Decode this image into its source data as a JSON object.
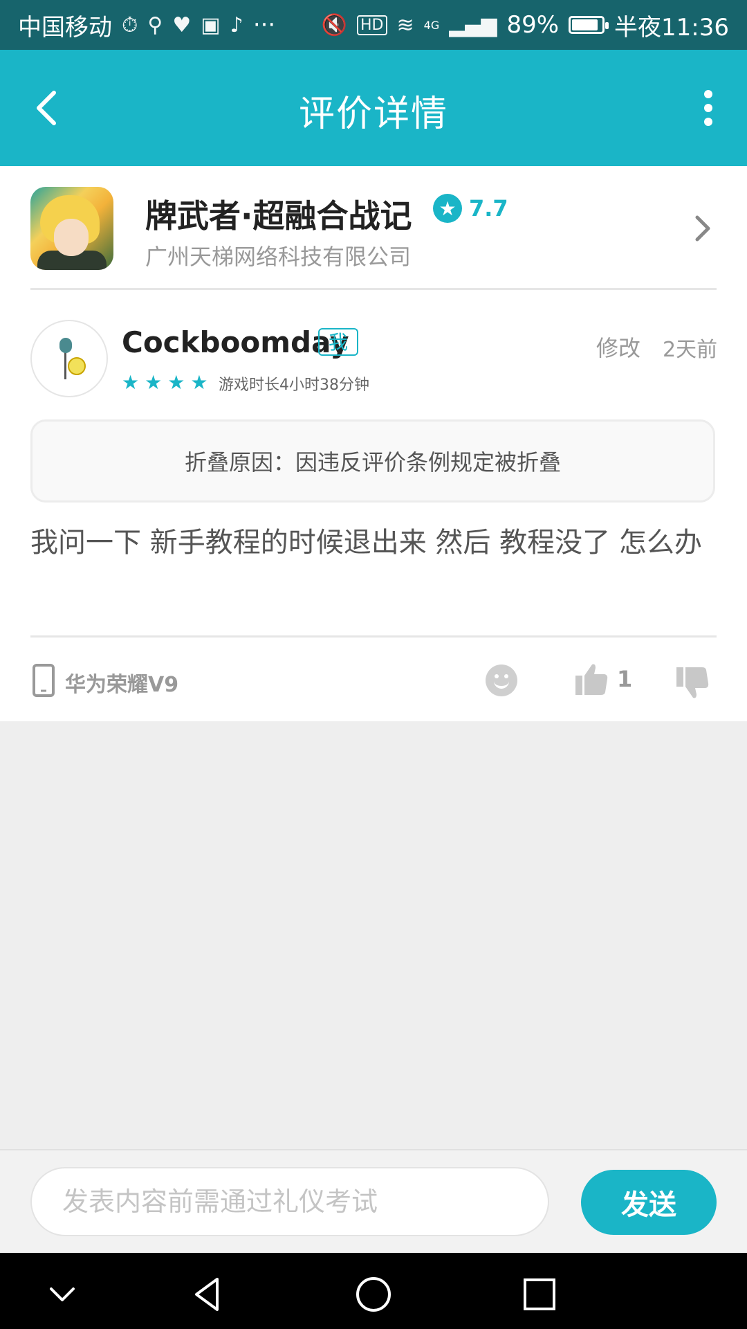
{
  "status_bar": {
    "carrier": "中国移动",
    "more": "···",
    "network": "4G",
    "battery": "89%",
    "battery_level": 0.89,
    "time": "半夜11:36"
  },
  "header": {
    "title": "评价详情"
  },
  "game": {
    "name": "牌武者·超融合战记",
    "score": "7.7",
    "developer": "广州天梯网络科技有限公司"
  },
  "review": {
    "username": "Cockboomday",
    "me_badge": "我",
    "edit_label": "修改",
    "time_ago": "2天前",
    "stars": 4,
    "playtime": "游戏时长4小时38分钟",
    "fold_reason": "折叠原因：因违反评价条例规定被折叠",
    "text": "我问一下 新手教程的时候退出来 然后 教程没了 怎么办",
    "device": "华为荣耀V9",
    "like_count": "1"
  },
  "composer": {
    "placeholder": "发表内容前需通过礼仪考试",
    "send_label": "发送"
  },
  "colors": {
    "accent": "#1ab5c7",
    "status_bar": "#17646c"
  }
}
